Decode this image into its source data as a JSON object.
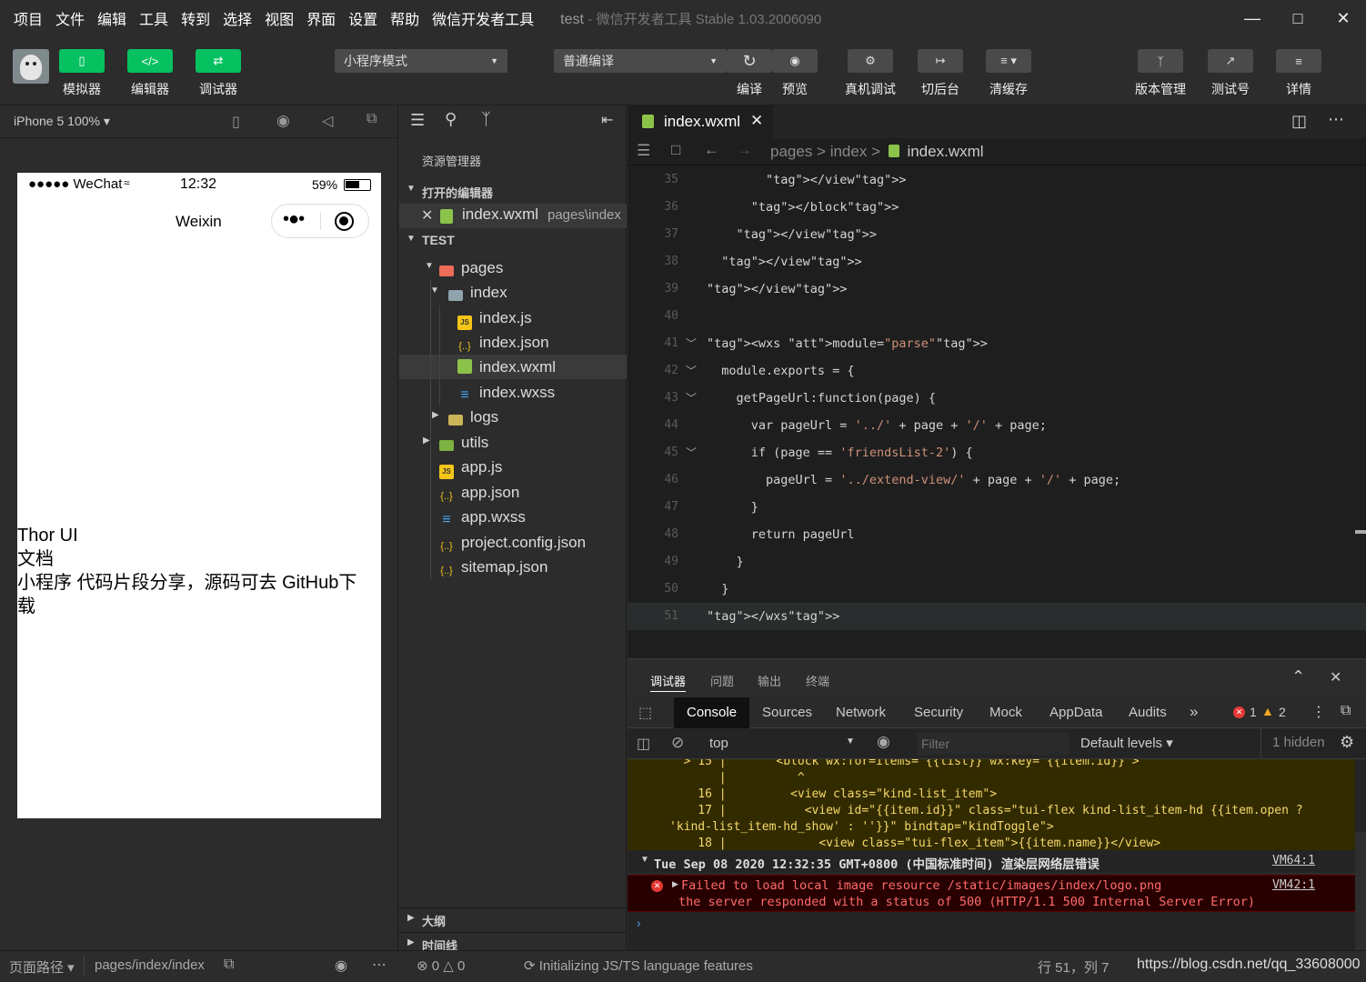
{
  "menu": [
    "项目",
    "文件",
    "编辑",
    "工具",
    "转到",
    "选择",
    "视图",
    "界面",
    "设置",
    "帮助",
    "微信开发者工具"
  ],
  "app_title": "test",
  "app_subtitle": "- 微信开发者工具 Stable 1.03.2006090",
  "toolbar": {
    "simulator": "模拟器",
    "editor": "编辑器",
    "debugger": "调试器",
    "mode_select": "小程序模式",
    "compile_select": "普通编译",
    "compile": "编译",
    "preview": "预览",
    "remote_debug": "真机调试",
    "background": "切后台",
    "clear_cache": "清缓存",
    "version_mgmt": "版本管理",
    "test_account": "测试号",
    "details": "详情"
  },
  "simulator": {
    "device": "iPhone 5 100%",
    "status_carrier": "●●●●● WeChat",
    "status_time": "12:32",
    "status_battery": "59%",
    "nav_title": "Weixin",
    "content_line1": "Thor UI",
    "content_line2": "文档",
    "content_line3": "小程序 代码片段分享，源码可去 GitHub下载"
  },
  "explorer": {
    "title": "资源管理器",
    "open_editors": "打开的编辑器",
    "open_file": "index.wxml",
    "open_file_path": "pages\\index",
    "project": "TEST",
    "tree": [
      {
        "name": "pages",
        "type": "folder-red"
      },
      {
        "name": "index",
        "type": "folder"
      },
      {
        "name": "index.js",
        "type": "js"
      },
      {
        "name": "index.json",
        "type": "json"
      },
      {
        "name": "index.wxml",
        "type": "wxml"
      },
      {
        "name": "index.wxss",
        "type": "wxss"
      },
      {
        "name": "logs",
        "type": "folder-yellow"
      },
      {
        "name": "utils",
        "type": "folder-green"
      },
      {
        "name": "app.js",
        "type": "js"
      },
      {
        "name": "app.json",
        "type": "json"
      },
      {
        "name": "app.wxss",
        "type": "wxss"
      },
      {
        "name": "project.config.json",
        "type": "json"
      },
      {
        "name": "sitemap.json",
        "type": "json"
      }
    ],
    "outline": "大纲",
    "timeline": "时间线"
  },
  "editor": {
    "tab": "index.wxml",
    "breadcrumb": [
      "pages",
      "index",
      "index.wxml"
    ],
    "lines": [
      {
        "n": "35",
        "code": "        </view>"
      },
      {
        "n": "36",
        "code": "      </block>"
      },
      {
        "n": "37",
        "code": "    </view>"
      },
      {
        "n": "38",
        "code": "  </view>"
      },
      {
        "n": "39",
        "code": "</view>"
      },
      {
        "n": "40",
        "code": ""
      },
      {
        "n": "41",
        "code": "<wxs module=\"parse\">"
      },
      {
        "n": "42",
        "code": "  module.exports = {"
      },
      {
        "n": "43",
        "code": "    getPageUrl:function(page) {"
      },
      {
        "n": "44",
        "code": "      var pageUrl = '../' + page + '/' + page;"
      },
      {
        "n": "45",
        "code": "      if (page == 'friendsList-2') {"
      },
      {
        "n": "46",
        "code": "        pageUrl = '../extend-view/' + page + '/' + page;"
      },
      {
        "n": "47",
        "code": "      }"
      },
      {
        "n": "48",
        "code": "      return pageUrl"
      },
      {
        "n": "49",
        "code": "    }"
      },
      {
        "n": "50",
        "code": "  }"
      },
      {
        "n": "51",
        "code": "</wxs>"
      }
    ]
  },
  "devtools": {
    "panel_tabs": [
      "调试器",
      "问题",
      "输出",
      "终端"
    ],
    "tabs": [
      "Console",
      "Sources",
      "Network",
      "Security",
      "Mock",
      "AppData",
      "Audits"
    ],
    "errors": "1",
    "warnings": "2",
    "context": "top",
    "filter_placeholder": "Filter",
    "levels": "Default levels",
    "hidden": "1 hidden",
    "warn_lines": [
      "  > 15 |       <block wx:for=items= {{list}} wx:key= {{item.id}} >",
      "       |          ^",
      "    16 |         <view class=\"kind-list_item\">",
      "    17 |           <view id=\"{{item.id}}\" class=\"tui-flex kind-list_item-hd {{item.open ?",
      "'kind-list_item-hd_show' : ''}}\" bindtap=\"kindToggle\">",
      "    18 |             <view class=\"tui-flex_item\">{{item.name}}</view>"
    ],
    "group_header": "Tue Sep 08 2020 12:32:35 GMT+0800 (中国标准时间) 渲染层网络层错误",
    "group_link": "VM64:1",
    "error_line1": "Failed to load local image resource /static/images/index/logo.png",
    "error_line2": "the server responded with a status of 500 (HTTP/1.1 500 Internal Server Error)",
    "error_link": "VM42:1"
  },
  "status": {
    "page_path_label": "页面路径",
    "page_path": "pages/index/index",
    "problems_err": "0",
    "problems_warn": "0",
    "init_msg": "Initializing JS/TS language features",
    "cursor": "行 51，列 7",
    "url": "https://blog.csdn.net/qq_33608000"
  }
}
